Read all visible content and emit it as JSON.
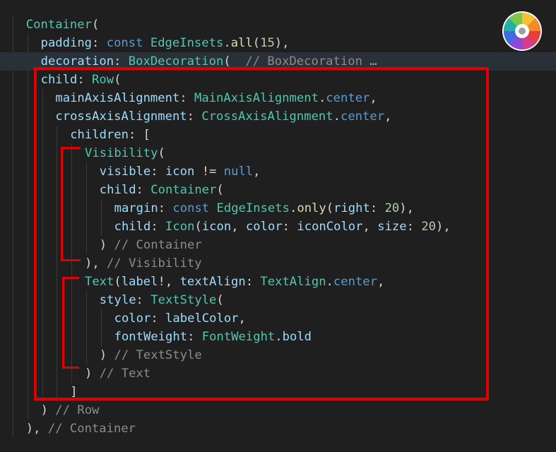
{
  "code": {
    "lines": [
      {
        "indent": 1,
        "tokens": [
          {
            "t": "Container",
            "c": "type"
          },
          {
            "t": "(",
            "c": "p"
          }
        ]
      },
      {
        "indent": 2,
        "tokens": [
          {
            "t": "padding",
            "c": "prop"
          },
          {
            "t": ": ",
            "c": "p"
          },
          {
            "t": "const",
            "c": "kw"
          },
          {
            "t": " ",
            "c": "p"
          },
          {
            "t": "EdgeInsets",
            "c": "type"
          },
          {
            "t": ".",
            "c": "p"
          },
          {
            "t": "all",
            "c": "fn"
          },
          {
            "t": "(",
            "c": "p"
          },
          {
            "t": "15",
            "c": "num"
          },
          {
            "t": "),",
            "c": "p"
          }
        ]
      },
      {
        "indent": 2,
        "highlight": true,
        "tokens": [
          {
            "t": "decoration",
            "c": "prop"
          },
          {
            "t": ": ",
            "c": "p"
          },
          {
            "t": "BoxDecoration",
            "c": "type"
          },
          {
            "t": "(  ",
            "c": "p"
          },
          {
            "t": "// BoxDecoration",
            "c": "cmt"
          },
          {
            "t": " …",
            "c": "ell"
          }
        ]
      },
      {
        "indent": 2,
        "tokens": [
          {
            "t": "child",
            "c": "prop"
          },
          {
            "t": ": ",
            "c": "p"
          },
          {
            "t": "Row",
            "c": "type"
          },
          {
            "t": "(",
            "c": "p"
          }
        ]
      },
      {
        "indent": 3,
        "tokens": [
          {
            "t": "mainAxisAlignment",
            "c": "prop"
          },
          {
            "t": ": ",
            "c": "p"
          },
          {
            "t": "MainAxisAlignment",
            "c": "type"
          },
          {
            "t": ".",
            "c": "p"
          },
          {
            "t": "center",
            "c": "kw"
          },
          {
            "t": ",",
            "c": "p"
          }
        ]
      },
      {
        "indent": 3,
        "tokens": [
          {
            "t": "crossAxisAlignment",
            "c": "prop"
          },
          {
            "t": ": ",
            "c": "p"
          },
          {
            "t": "CrossAxisAlignment",
            "c": "type"
          },
          {
            "t": ".",
            "c": "p"
          },
          {
            "t": "center",
            "c": "kw"
          },
          {
            "t": ",",
            "c": "p"
          }
        ]
      },
      {
        "indent": 4,
        "tokens": [
          {
            "t": "children",
            "c": "prop"
          },
          {
            "t": ": [",
            "c": "p"
          }
        ]
      },
      {
        "indent": 5,
        "tokens": [
          {
            "t": "Visibility",
            "c": "type"
          },
          {
            "t": "(",
            "c": "p"
          }
        ]
      },
      {
        "indent": 6,
        "tokens": [
          {
            "t": "visible",
            "c": "prop"
          },
          {
            "t": ": ",
            "c": "p"
          },
          {
            "t": "icon",
            "c": "prop"
          },
          {
            "t": " != ",
            "c": "p"
          },
          {
            "t": "null",
            "c": "kw"
          },
          {
            "t": ",",
            "c": "p"
          }
        ]
      },
      {
        "indent": 6,
        "tokens": [
          {
            "t": "child",
            "c": "prop"
          },
          {
            "t": ": ",
            "c": "p"
          },
          {
            "t": "Container",
            "c": "type"
          },
          {
            "t": "(",
            "c": "p"
          }
        ]
      },
      {
        "indent": 7,
        "tokens": [
          {
            "t": "margin",
            "c": "prop"
          },
          {
            "t": ": ",
            "c": "p"
          },
          {
            "t": "const",
            "c": "kw"
          },
          {
            "t": " ",
            "c": "p"
          },
          {
            "t": "EdgeInsets",
            "c": "type"
          },
          {
            "t": ".",
            "c": "p"
          },
          {
            "t": "only",
            "c": "fn"
          },
          {
            "t": "(",
            "c": "p"
          },
          {
            "t": "right",
            "c": "prop"
          },
          {
            "t": ": ",
            "c": "p"
          },
          {
            "t": "20",
            "c": "num"
          },
          {
            "t": "),",
            "c": "p"
          }
        ]
      },
      {
        "indent": 7,
        "tokens": [
          {
            "t": "child",
            "c": "prop"
          },
          {
            "t": ": ",
            "c": "p"
          },
          {
            "t": "Icon",
            "c": "type"
          },
          {
            "t": "(",
            "c": "p"
          },
          {
            "t": "icon",
            "c": "prop"
          },
          {
            "t": ", ",
            "c": "p"
          },
          {
            "t": "color",
            "c": "prop"
          },
          {
            "t": ": ",
            "c": "p"
          },
          {
            "t": "iconColor",
            "c": "prop"
          },
          {
            "t": ", ",
            "c": "p"
          },
          {
            "t": "size",
            "c": "prop"
          },
          {
            "t": ": ",
            "c": "p"
          },
          {
            "t": "20",
            "c": "num"
          },
          {
            "t": "),",
            "c": "p"
          }
        ]
      },
      {
        "indent": 6,
        "tokens": [
          {
            "t": ") ",
            "c": "p"
          },
          {
            "t": "// Container",
            "c": "cmt"
          }
        ]
      },
      {
        "indent": 5,
        "tokens": [
          {
            "t": "), ",
            "c": "p"
          },
          {
            "t": "// Visibility",
            "c": "cmt"
          }
        ]
      },
      {
        "indent": 5,
        "tokens": [
          {
            "t": "Text",
            "c": "type"
          },
          {
            "t": "(",
            "c": "p"
          },
          {
            "t": "label",
            "c": "prop"
          },
          {
            "t": "!, ",
            "c": "p"
          },
          {
            "t": "textAlign",
            "c": "prop"
          },
          {
            "t": ": ",
            "c": "p"
          },
          {
            "t": "TextAlign",
            "c": "type"
          },
          {
            "t": ".",
            "c": "p"
          },
          {
            "t": "center",
            "c": "kw"
          },
          {
            "t": ",",
            "c": "p"
          }
        ]
      },
      {
        "indent": 6,
        "tokens": [
          {
            "t": "style",
            "c": "prop"
          },
          {
            "t": ": ",
            "c": "p"
          },
          {
            "t": "TextStyle",
            "c": "type"
          },
          {
            "t": "(",
            "c": "p"
          }
        ]
      },
      {
        "indent": 7,
        "tokens": [
          {
            "t": "color",
            "c": "prop"
          },
          {
            "t": ": ",
            "c": "p"
          },
          {
            "t": "labelColor",
            "c": "prop"
          },
          {
            "t": ",",
            "c": "p"
          }
        ]
      },
      {
        "indent": 7,
        "tokens": [
          {
            "t": "fontWeight",
            "c": "prop"
          },
          {
            "t": ": ",
            "c": "p"
          },
          {
            "t": "FontWeight",
            "c": "type"
          },
          {
            "t": ".",
            "c": "p"
          },
          {
            "t": "bold",
            "c": "prop"
          }
        ]
      },
      {
        "indent": 6,
        "tokens": [
          {
            "t": ") ",
            "c": "p"
          },
          {
            "t": "// TextStyle",
            "c": "cmt"
          }
        ]
      },
      {
        "indent": 5,
        "tokens": [
          {
            "t": ") ",
            "c": "p"
          },
          {
            "t": "// Text",
            "c": "cmt"
          }
        ]
      },
      {
        "indent": 4,
        "tokens": [
          {
            "t": "]",
            "c": "p"
          }
        ]
      },
      {
        "indent": 2,
        "tokens": [
          {
            "t": ") ",
            "c": "p"
          },
          {
            "t": "// Row",
            "c": "cmt"
          }
        ]
      },
      {
        "indent": 1,
        "tokens": [
          {
            "t": "), ",
            "c": "p"
          },
          {
            "t": "// Container",
            "c": "cmt"
          }
        ]
      }
    ]
  },
  "colors": {
    "background": "#1f1f1f",
    "annotation_red": "#e00000"
  },
  "logo": {
    "icon": "color-wheel-icon"
  }
}
